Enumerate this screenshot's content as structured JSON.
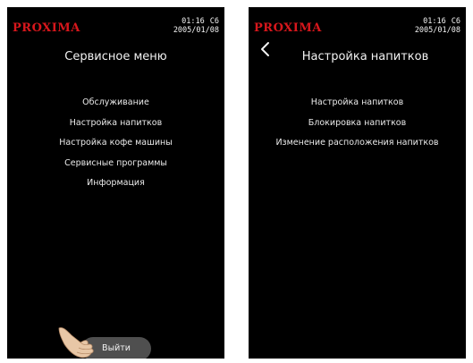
{
  "left_screen": {
    "brand": "PROXIMA",
    "status": {
      "time": "01:16",
      "code": "C6",
      "date": "2005/01/08"
    },
    "title": "Сервисное меню",
    "menu_items": [
      "Обслуживание",
      "Настройка напитков",
      "Настройка кофе машины",
      "Сервисные программы",
      "Информация"
    ],
    "exit_label": "Выйти",
    "hand_icon": "hand-pointer-icon"
  },
  "right_screen": {
    "brand": "PROXIMA",
    "status": {
      "time": "01:16",
      "code": "C6",
      "date": "2005/01/08"
    },
    "title": "Настройка напитков",
    "back_icon": "chevron-left-icon",
    "menu_items": [
      "Настройка напитков",
      "Блокировка напитков",
      "Изменение расположения напитков"
    ]
  },
  "colors": {
    "screen_background": "#000000",
    "brand": "#d8171c",
    "text": "#ebebeb",
    "exit_button": "#4f4f4f"
  }
}
